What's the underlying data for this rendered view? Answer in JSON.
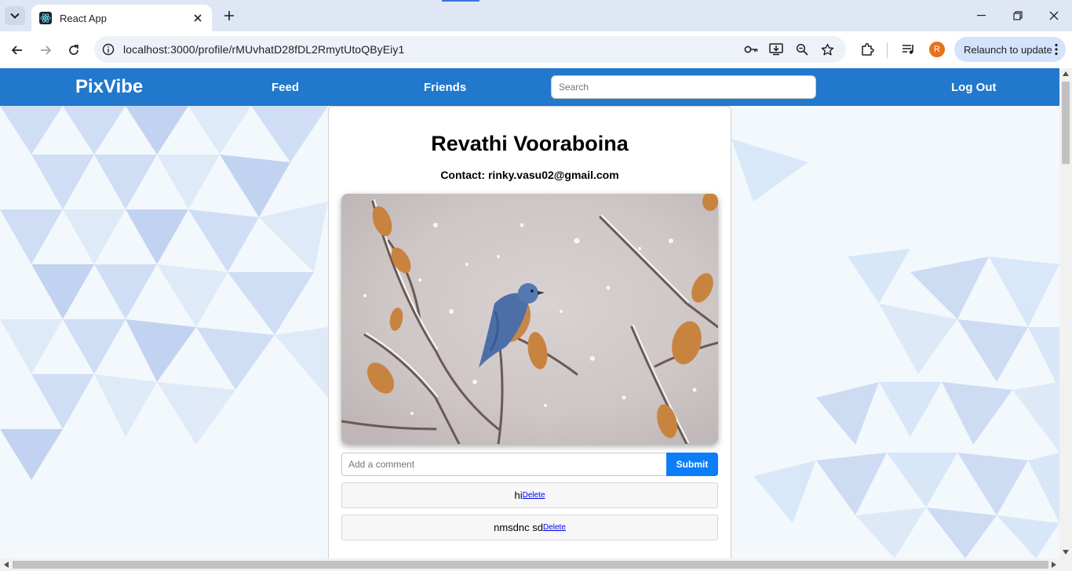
{
  "browser": {
    "tab_title": "React App",
    "url": "localhost:3000/profile/rMUvhatD28fDL2RmytUtoQByEiy1",
    "relaunch_label": "Relaunch to update",
    "profile_initial": "R"
  },
  "app": {
    "brand": "PixVibe",
    "nav": {
      "feed": "Feed",
      "friends": "Friends",
      "logout": "Log Out"
    },
    "search": {
      "placeholder": "Search",
      "value": ""
    }
  },
  "profile": {
    "name": "Revathi Vooraboina",
    "contact_label": "Contact:",
    "contact_email": "rinky.vasu02@gmail.com"
  },
  "post": {
    "image_alt": "Bluebird perched on snowy branch with autumn leaves",
    "comment_placeholder": "Add a comment",
    "submit_label": "Submit",
    "comments": [
      {
        "text": "hi",
        "delete_label": "Delete"
      },
      {
        "text": "nmsdnc sd",
        "delete_label": "Delete"
      }
    ]
  },
  "colors": {
    "navbar": "#2178cc",
    "submit": "#0b7df8",
    "chrome": "#dfe7f5"
  }
}
